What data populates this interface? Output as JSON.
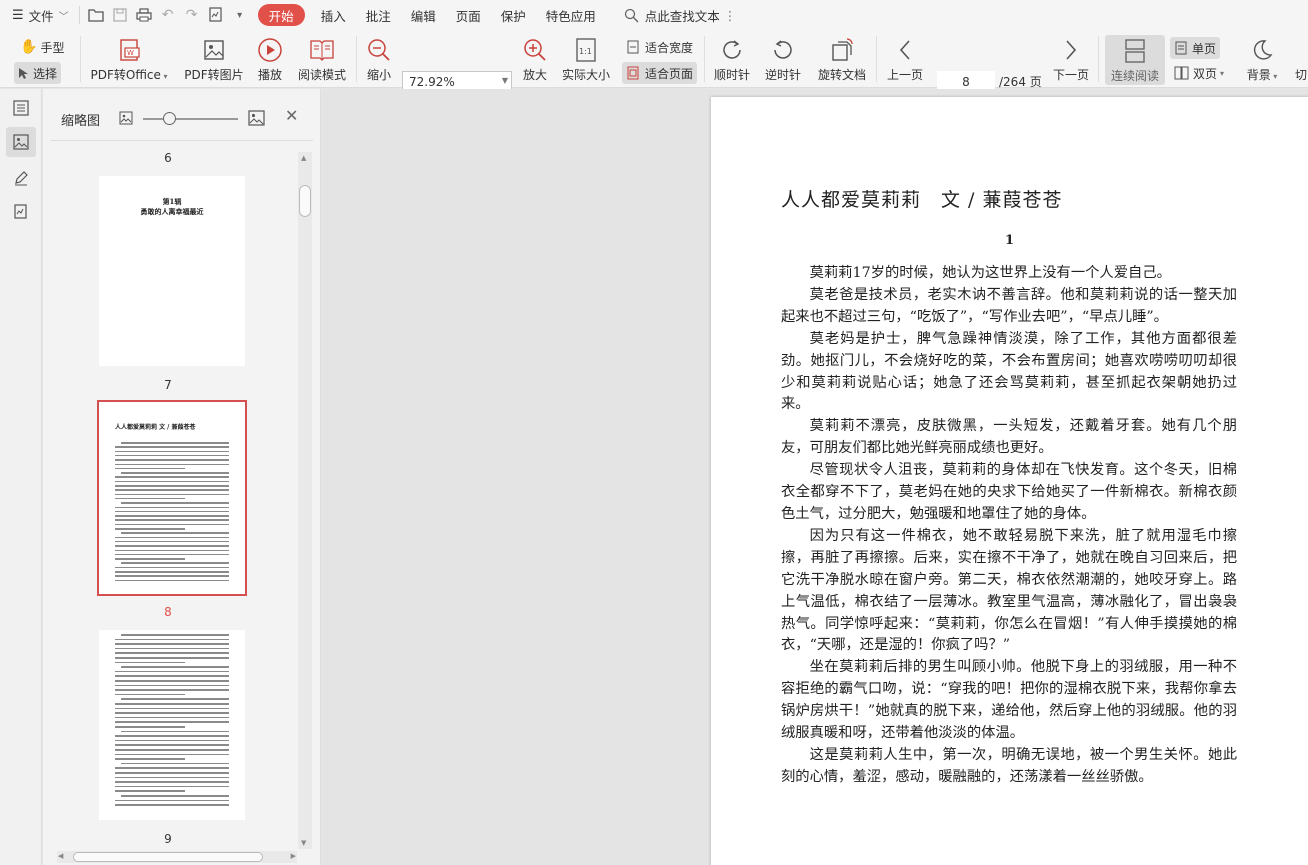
{
  "menubar": {
    "file_label": "文件",
    "items": [
      {
        "label": "开始",
        "active": true
      },
      {
        "label": "插入"
      },
      {
        "label": "批注"
      },
      {
        "label": "编辑"
      },
      {
        "label": "页面"
      },
      {
        "label": "保护"
      },
      {
        "label": "特色应用"
      }
    ],
    "search_label": "点此查找文本"
  },
  "ribbon": {
    "hand": "手型",
    "select": "选择",
    "pdf_to_office": "PDF转Office",
    "pdf_to_image": "PDF转图片",
    "play": "播放",
    "read_mode": "阅读模式",
    "zoom_out": "缩小",
    "zoom_value": "72.92%",
    "zoom_in": "放大",
    "actual_size": "实际大小",
    "actual_size_icon": "1:1",
    "fit_width": "适合宽度",
    "fit_page": "适合页面",
    "clockwise": "顺时针",
    "counter_clockwise": "逆时针",
    "rotate_doc": "旋转文档",
    "prev_page": "上一页",
    "page_current": "8",
    "page_total": "/264 页",
    "next_page": "下一页",
    "continuous": "连续阅读",
    "single": "单页",
    "double": "双页",
    "background": "背景",
    "switch_partial": "切"
  },
  "thumbnails": {
    "title": "缩略图",
    "pages": [
      {
        "num": "6"
      },
      {
        "num": "7"
      },
      {
        "num": "8",
        "current": true
      },
      {
        "num": "9"
      }
    ],
    "page6_text": [
      "第1辑",
      "勇敢的人离幸福最近"
    ],
    "page8_title": "人人都爱莫莉莉 文 / 兼葭苍苍"
  },
  "document": {
    "title": "人人都爱莫莉莉　文 / 蒹葭苍苍",
    "section": "1",
    "paragraphs": [
      "莫莉莉17岁的时候，她认为这世界上没有一个人爱自己。",
      "莫老爸是技术员，老实木讷不善言辞。他和莫莉莉说的话一整天加起来也不超过三句，“吃饭了”，“写作业去吧”，“早点儿睡”。",
      "莫老妈是护士，脾气急躁神情淡漠，除了工作，其他方面都很差劲。她抠门儿，不会烧好吃的菜，不会布置房间；她喜欢唠唠叨叨却很少和莫莉莉说贴心话；她急了还会骂莫莉莉，甚至抓起衣架朝她扔过来。",
      "莫莉莉不漂亮，皮肤微黑，一头短发，还戴着牙套。她有几个朋友，可朋友们都比她光鲜亮丽成绩也更好。",
      "尽管现状令人沮丧，莫莉莉的身体却在飞快发育。这个冬天，旧棉衣全都穿不下了，莫老妈在她的央求下给她买了一件新棉衣。新棉衣颜色土气，过分肥大，勉强暖和地罩住了她的身体。",
      "因为只有这一件棉衣，她不敢轻易脱下来洗，脏了就用湿毛巾擦擦，再脏了再擦擦。后来，实在擦不干净了，她就在晚自习回来后，把它洗干净脱水晾在窗户旁。第二天，棉衣依然潮潮的，她咬牙穿上。路上气温低，棉衣结了一层薄冰。教室里气温高，薄冰融化了，冒出袅袅热气。同学惊呼起来：“莫莉莉，你怎么在冒烟！”有人伸手摸摸她的棉衣，“天哪，还是湿的！你疯了吗？”",
      "坐在莫莉莉后排的男生叫顾小帅。他脱下身上的羽绒服，用一种不容拒绝的霸气口吻，说：“穿我的吧！把你的湿棉衣脱下来，我帮你拿去锅炉房烘干！”她就真的脱下来，递给他，然后穿上他的羽绒服。他的羽绒服真暖和呀，还带着他淡淡的体温。",
      "这是莫莉莉人生中，第一次，明确无误地，被一个男生关怀。她此刻的心情，羞涩，感动，暖融融的，还荡漾着一丝丝骄傲。"
    ]
  },
  "colors": {
    "accent": "#e2504a",
    "selection_border": "#d45050"
  }
}
